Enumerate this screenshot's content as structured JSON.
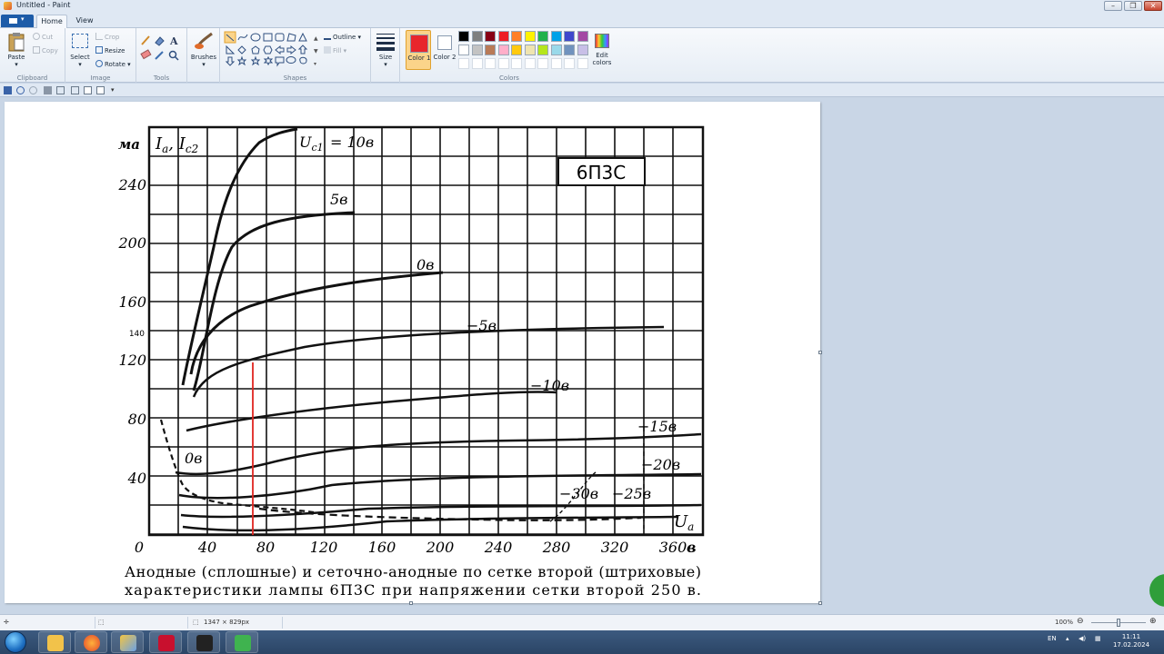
{
  "window": {
    "title": "Untitled - Paint"
  },
  "tabs": {
    "home": "Home",
    "view": "View"
  },
  "ribbon": {
    "clipboard": {
      "paste": "Paste",
      "cut": "Cut",
      "copy": "Copy",
      "label": "Clipboard"
    },
    "image": {
      "select": "Select",
      "crop": "Crop",
      "resize": "Resize",
      "rotate": "Rotate",
      "label": "Image"
    },
    "tools": {
      "label": "Tools"
    },
    "brushes": {
      "label": "Brushes"
    },
    "shapes": {
      "outline": "Outline",
      "fill": "Fill",
      "label": "Shapes"
    },
    "size": {
      "label": "Size"
    },
    "color1": {
      "label": "Color 1",
      "value": "#e8262c"
    },
    "color2": {
      "label": "Color 2",
      "value": "#ffffff"
    },
    "colors": {
      "label": "Colors",
      "edit": "Edit colors"
    },
    "palette_row1": [
      "#000000",
      "#7f7f7f",
      "#880015",
      "#ed1c24",
      "#ff7f27",
      "#fff200",
      "#22b14c",
      "#00a2e8",
      "#3f48cc",
      "#a349a4"
    ],
    "palette_row2": [
      "#ffffff",
      "#c3c3c3",
      "#b97a57",
      "#ffaec9",
      "#ffc90e",
      "#efe4b0",
      "#b5e61d",
      "#99d9ea",
      "#7092be",
      "#c8bfe7"
    ]
  },
  "canvas_image": {
    "y_unit": "ма",
    "y_axis_title": "I",
    "y_axis_title_sub_a": "a",
    "y_axis_title_sep": ", I",
    "y_axis_title_sub_c2": "c2",
    "y_ticks": [
      "240",
      "200",
      "160",
      "140",
      "120",
      "80",
      "40"
    ],
    "x_ticks": [
      "0",
      "40",
      "80",
      "120",
      "160",
      "200",
      "240",
      "280",
      "320",
      "360"
    ],
    "x_unit": "в",
    "x_axis_title": "U",
    "x_axis_title_sub": "a",
    "tube_label": "6П3С",
    "curve_prefix": "U",
    "curve_prefix_sub": "c1",
    "curve_labels": [
      "= 10в",
      "5в",
      "0в",
      "−5в",
      "−10в",
      "−15в",
      "−20в",
      "−25в",
      "−30в",
      "0в"
    ],
    "caption_line1": "Анодные (сплошные) и сеточно-анодные по сетке второй (штриховые)",
    "caption_line2": "характеристики лампы 6П3С при напряжении сетки второй 250 в."
  },
  "statusbar": {
    "dimensions": "1347 × 829px",
    "zoom": "100%"
  },
  "taskbar": {
    "lang": "EN",
    "time": "11:11",
    "date": "17.02.2024"
  }
}
